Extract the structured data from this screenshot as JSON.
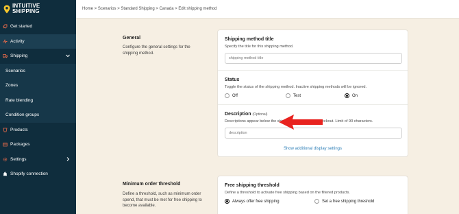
{
  "brand": {
    "line1": "INTUITIVE",
    "line2": "SHIPPING",
    "pin_color": "#f5c52b"
  },
  "sidebar": {
    "items": [
      {
        "label": "Get started",
        "icon": "rocket-icon"
      },
      {
        "label": "Activity",
        "icon": "activity-icon"
      },
      {
        "label": "Shipping",
        "icon": "truck-icon"
      },
      {
        "label": "Scenarios"
      },
      {
        "label": "Zones"
      },
      {
        "label": "Rate blending"
      },
      {
        "label": "Condition groups"
      },
      {
        "label": "Products",
        "icon": "product-icon"
      },
      {
        "label": "Packages",
        "icon": "package-icon"
      },
      {
        "label": "Settings",
        "icon": "gear-icon"
      },
      {
        "label": "Shopify connection",
        "icon": "shopify-icon"
      }
    ]
  },
  "breadcrumb": "Home > Scenarios > Standard Shipping > Canada > Edit shipping method",
  "general": {
    "title": "General",
    "desc": "Configure the general settings for the shipping method."
  },
  "shipping_method_title": {
    "title": "Shipping method title",
    "desc": "Specify the title for this shipping method.",
    "placeholder": "shipping method title"
  },
  "status": {
    "title": "Status",
    "desc": "Toggle the status of the shipping method. Inactive shipping methods will be ignored.",
    "options": [
      "Off",
      "Test",
      "On"
    ],
    "selected": "On"
  },
  "description": {
    "title": "Description",
    "optional": "(Optional)",
    "desc": "Descriptions appear below the shipping method title at checkout. Limit of 90 characters.",
    "placeholder": "description"
  },
  "show_additional": "Show additional display settings",
  "min_order": {
    "title": "Minimum order threshold",
    "desc": "Define a threshold, such as minimum order spend, that must be met for free shipping to become available."
  },
  "free_shipping": {
    "title": "Free shipping threshold",
    "desc": "Define a threshold to activate free shipping based on the filtered products.",
    "options": [
      "Always offer free shipping",
      "Set a free shipping threshold"
    ],
    "selected": "Always offer free shipping"
  },
  "colors": {
    "sidebar": "#0f2d3d",
    "arrow": "#e8231f",
    "link": "#2e7fb7",
    "background": "#f6efe3"
  }
}
